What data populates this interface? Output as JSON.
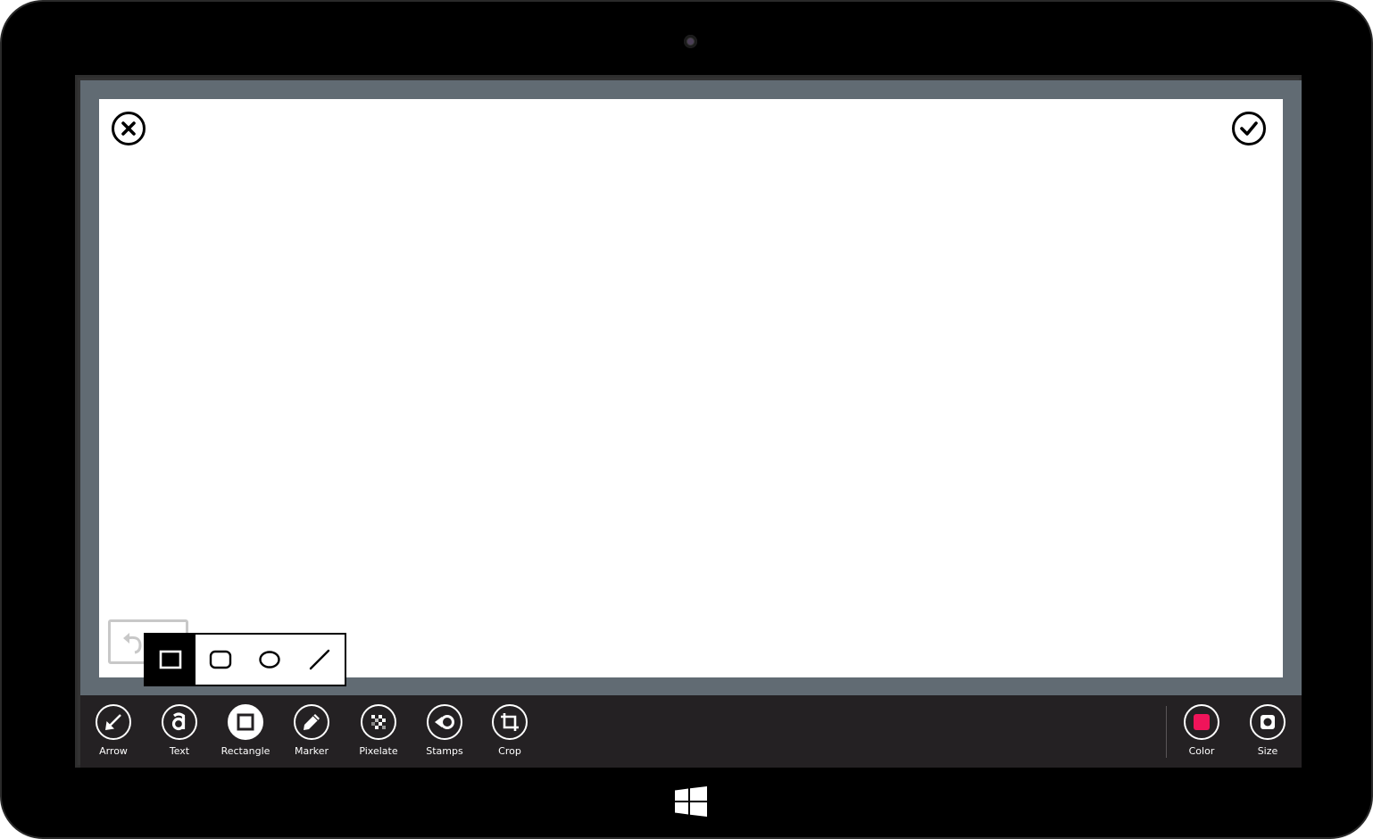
{
  "toolbar": {
    "tools": [
      {
        "id": "arrow",
        "label": "Arrow",
        "icon": "arrow-icon"
      },
      {
        "id": "text",
        "label": "Text",
        "icon": "text-a-icon"
      },
      {
        "id": "rectangle",
        "label": "Rectangle",
        "icon": "rectangle-icon",
        "selected": true
      },
      {
        "id": "marker",
        "label": "Marker",
        "icon": "pencil-icon"
      },
      {
        "id": "pixelate",
        "label": "Pixelate",
        "icon": "pixelate-icon"
      },
      {
        "id": "stamps",
        "label": "Stamps",
        "icon": "stamp-icon"
      },
      {
        "id": "crop",
        "label": "Crop",
        "icon": "crop-icon"
      }
    ],
    "right_tools": [
      {
        "id": "color",
        "label": "Color",
        "icon": "color-swatch-icon"
      },
      {
        "id": "size",
        "label": "Size",
        "icon": "size-icon"
      }
    ]
  },
  "shape_options": [
    {
      "id": "square",
      "icon": "square-shape-icon",
      "active": true
    },
    {
      "id": "rounded-rect",
      "icon": "rounded-rect-shape-icon"
    },
    {
      "id": "ellipse",
      "icon": "ellipse-shape-icon"
    },
    {
      "id": "line",
      "icon": "line-shape-icon"
    }
  ],
  "colors": {
    "selected_color": "#f0145a",
    "appbar_bg": "#242123",
    "frame_bg": "#616b73"
  },
  "icons": {
    "close": "close-icon",
    "done": "checkmark-icon",
    "undo": "undo-icon",
    "windows": "windows-logo-icon",
    "camera": "camera-icon"
  }
}
